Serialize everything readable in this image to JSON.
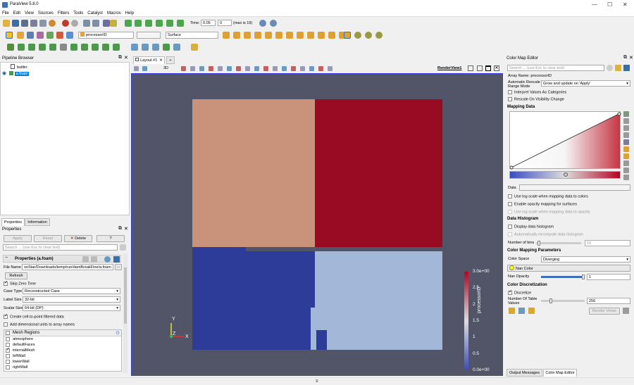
{
  "app": {
    "title": "ParaView 5.8.0"
  },
  "menu": [
    "File",
    "Edit",
    "View",
    "Sources",
    "Filters",
    "Tools",
    "Catalyst",
    "Macros",
    "Help"
  ],
  "toolbar": {
    "time_label": "Time:",
    "time_value": "0.05",
    "time_step": "0",
    "time_max": "(max is 19)",
    "color_by": "processorID",
    "representation": "Surface"
  },
  "pipeline": {
    "title": "Pipeline Browser",
    "items": [
      "builtin:",
      "a.foam"
    ]
  },
  "properties": {
    "tabs": [
      "Properties",
      "Information"
    ],
    "title": "Properties",
    "apply": "Apply",
    "reset": "Reset",
    "delete": "Delete",
    "help": "?",
    "search_placeholder": "Search ... (use Esc to clear text)",
    "section": "Properties (a.foam)",
    "file_name_label": "File Name",
    "file_name_value": "ooStar/Downloads/temp/run/damBreakFine/a.foam",
    "refresh": "Refresh",
    "skip_zero": "Skip Zero Time",
    "case_type_label": "Case Type",
    "case_type": "Reconstructed Case",
    "label_size_label": "Label Size",
    "label_size": "32-bit",
    "scalar_size_label": "Scalar Size",
    "scalar_size": "64-bit (DP)",
    "cell_to_point": "Create cell-to-point filtered data",
    "dim_units": "Add dimensional units to array names",
    "mesh_regions_label": "Mesh Regions",
    "mesh_regions": [
      {
        "name": "atmosphere",
        "checked": false
      },
      {
        "name": "defaultFaces",
        "checked": false
      },
      {
        "name": "internalMesh",
        "checked": true
      },
      {
        "name": "leftWall",
        "checked": false
      },
      {
        "name": "lowerWall",
        "checked": false
      },
      {
        "name": "rightWall",
        "checked": false
      }
    ]
  },
  "layout": {
    "tab": "Layout #1",
    "add": "+",
    "view_name": "RenderView1",
    "mode_3d": "3D"
  },
  "colorbar": {
    "title": "processorID",
    "ticks": [
      "3.0e+00",
      "2.5",
      "2",
      "1.5",
      "1",
      "0.5",
      "0.0e+00"
    ]
  },
  "axes": {
    "y": "Y",
    "z": "Z",
    "x": "X"
  },
  "cme": {
    "title": "Color Map Editor",
    "search_placeholder": "Search ... (use Esc to clear text)",
    "array_name": "Array Name: processorID",
    "auto_rescale_label": "Automatic Rescale Range Mode",
    "auto_rescale_value": "Grow and update on 'Apply'",
    "interpret_categories": "Interpret Values As Categories",
    "rescale_visibility": "Rescale On Visibility Change",
    "mapping_data": "Mapping Data",
    "data_label": "Data",
    "log_scale": "Use log scale when mapping data to colors",
    "opacity_surfaces": "Enable opacity mapping for surfaces",
    "log_opacity": "Use log scale when mapping data to opacity",
    "data_histogram": "Data Histogram",
    "display_histogram": "Display data histogram",
    "auto_recompute": "Automatically recompute data histogram",
    "num_bins_label": "Number of bins",
    "num_bins": "10",
    "color_mapping_params": "Color Mapping Parameters",
    "color_space_label": "Color Space",
    "color_space": "Diverging",
    "nan_color": "Nan Color",
    "nan_opacity_label": "Nan Opacity",
    "nan_opacity": "1",
    "color_discretization": "Color Discretization",
    "discretize": "Discretize",
    "num_table_values_label": "Number Of Table Values",
    "num_table_values": "256",
    "render_views": "Render Views",
    "bottom_tabs": [
      "Output Messages",
      "Color Map Editor"
    ]
  },
  "colors": {
    "q_tl": "#c8937a",
    "q_tr": "#980b23",
    "q_bl": "#2d3c99",
    "q_br": "#a3b7d9",
    "viewport": "#525467"
  }
}
